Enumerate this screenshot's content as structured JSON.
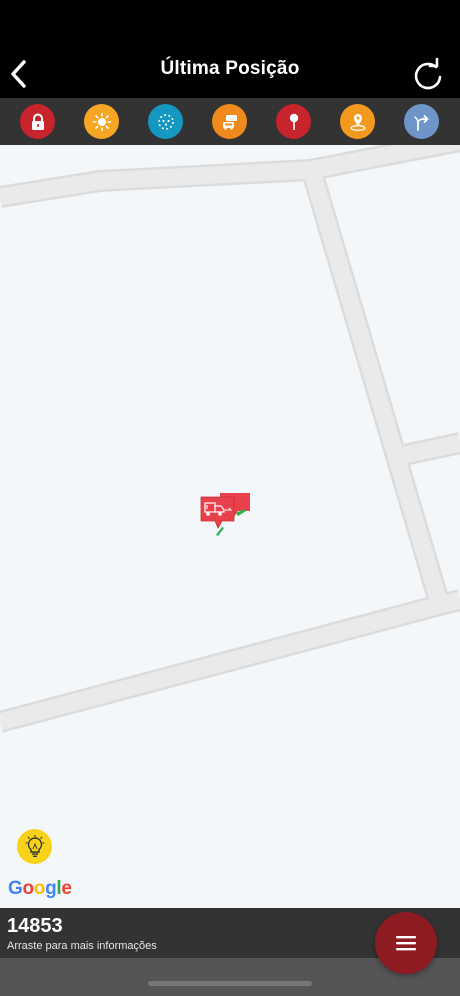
{
  "header": {
    "title": "Última Posição",
    "back_icon": "chevron-left-icon",
    "refresh_icon": "refresh-icon"
  },
  "toolbar": {
    "tools": [
      {
        "name": "lock",
        "icon": "lock-icon",
        "color": "#c8242c"
      },
      {
        "name": "sun",
        "icon": "sun-icon",
        "color": "#f6a623"
      },
      {
        "name": "dots-circle",
        "icon": "dotted-circle-icon",
        "color": "#1497c0"
      },
      {
        "name": "traffic",
        "icon": "cars-icon",
        "color": "#f08a1c"
      },
      {
        "name": "pin",
        "icon": "map-pin-icon",
        "color": "#c8242c"
      },
      {
        "name": "place",
        "icon": "location-icon",
        "color": "#f39a1e"
      },
      {
        "name": "directions",
        "icon": "directions-icon",
        "color": "#6e95c7"
      }
    ]
  },
  "map": {
    "logo_text": "Google",
    "lightbulb_icon": "lightbulb-icon",
    "marker_icon": "truck-icon",
    "marker_color": "#e8414b"
  },
  "info": {
    "vehicle_id": "14853",
    "hint": "Arraste para mais informações"
  },
  "fab": {
    "icon": "menu-icon",
    "color": "#8e1b22"
  }
}
